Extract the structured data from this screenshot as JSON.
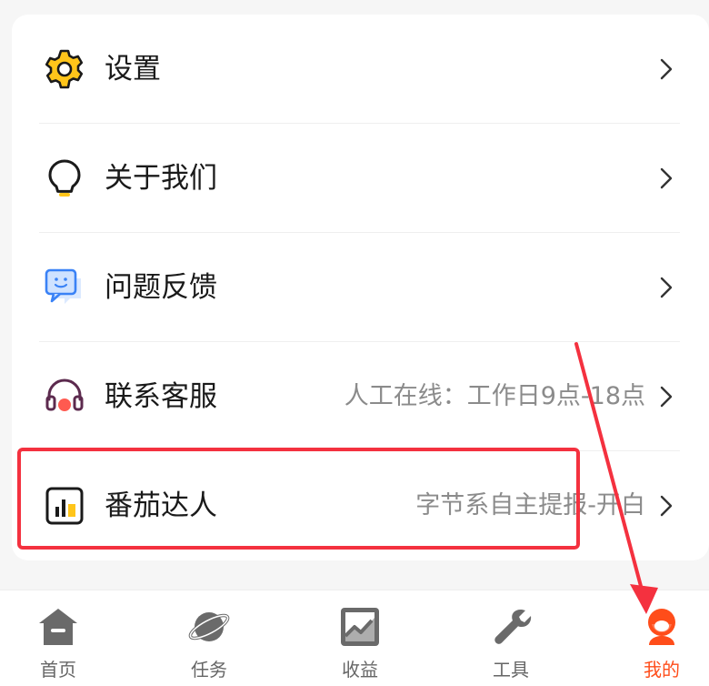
{
  "menu": {
    "items": [
      {
        "label": "设置",
        "sub": "",
        "icon": "gear-icon"
      },
      {
        "label": "关于我们",
        "sub": "",
        "icon": "lightbulb-icon"
      },
      {
        "label": "问题反馈",
        "sub": "",
        "icon": "chat-feedback-icon"
      },
      {
        "label": "联系客服",
        "sub": "人工在线：工作日9点-18点",
        "icon": "headset-icon"
      },
      {
        "label": "番茄达人",
        "sub": "字节系自主提报-开白",
        "icon": "bar-chart-icon"
      }
    ]
  },
  "tabbar": {
    "tabs": [
      {
        "label": "首页",
        "icon": "home-icon"
      },
      {
        "label": "任务",
        "icon": "planet-icon"
      },
      {
        "label": "收益",
        "icon": "earnings-chart-icon"
      },
      {
        "label": "工具",
        "icon": "wrench-icon"
      },
      {
        "label": "我的",
        "icon": "profile-icon"
      }
    ],
    "active_index": 4
  },
  "colors": {
    "accent": "#ff4d1a",
    "highlight_box": "#f4313f",
    "gear_yellow": "#ffc51a"
  }
}
